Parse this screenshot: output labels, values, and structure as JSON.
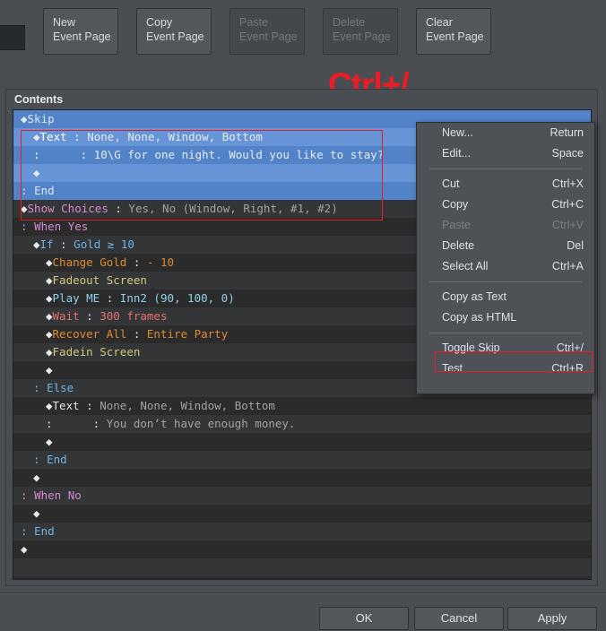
{
  "toolbar": {
    "buttons": [
      {
        "line1": "New",
        "line2": "Event Page",
        "disabled": false
      },
      {
        "line1": "Copy",
        "line2": "Event Page",
        "disabled": false
      },
      {
        "line1": "Paste",
        "line2": "Event Page",
        "disabled": true
      },
      {
        "line1": "Delete",
        "line2": "Event Page",
        "disabled": true
      },
      {
        "line1": "Clear",
        "line2": "Event Page",
        "disabled": false
      }
    ]
  },
  "annotation": {
    "shortcut_text": "Ctrl+/",
    "color": "#ed1c24"
  },
  "contents": {
    "label": "Contents",
    "rows": [
      {
        "selected": true,
        "indent": 0,
        "segs": [
          {
            "t": "◆",
            "c": "dia"
          },
          {
            "t": "Skip",
            "c": "c-blue"
          }
        ]
      },
      {
        "selected": true,
        "indent": 1,
        "segs": [
          {
            "t": "◆",
            "c": "dia"
          },
          {
            "t": "Text",
            "c": "c-white"
          },
          {
            "t": " : ",
            "c": "c-white"
          },
          {
            "t": "None, None, Window, Bottom",
            "c": "c-gray"
          }
        ]
      },
      {
        "selected": true,
        "indent": 1,
        "segs": [
          {
            "t": ":      : ",
            "c": "c-white"
          },
          {
            "t": "10\\G for one night. Would you like to stay?",
            "c": "c-gray"
          }
        ]
      },
      {
        "selected": true,
        "indent": 1,
        "segs": [
          {
            "t": "◆",
            "c": "dia"
          }
        ]
      },
      {
        "selected": true,
        "indent": 0,
        "segs": [
          {
            "t": ": ",
            "c": "c-blue"
          },
          {
            "t": "End",
            "c": "c-blue"
          }
        ]
      },
      {
        "selected": false,
        "indent": 0,
        "segs": [
          {
            "t": "◆",
            "c": "dia"
          },
          {
            "t": "Show Choices",
            "c": "c-pink"
          },
          {
            "t": " : ",
            "c": "c-white"
          },
          {
            "t": "Yes, No (Window, Right, #1, #2)",
            "c": "c-gray"
          }
        ]
      },
      {
        "selected": false,
        "indent": 0,
        "segs": [
          {
            "t": ": ",
            "c": "c-pink"
          },
          {
            "t": "When Yes",
            "c": "c-pink"
          }
        ]
      },
      {
        "selected": false,
        "indent": 1,
        "segs": [
          {
            "t": "◆",
            "c": "dia"
          },
          {
            "t": "If",
            "c": "c-blue"
          },
          {
            "t": " : ",
            "c": "c-white"
          },
          {
            "t": "Gold ≥ 10",
            "c": "c-blue"
          }
        ]
      },
      {
        "selected": false,
        "indent": 2,
        "segs": [
          {
            "t": "◆",
            "c": "dia"
          },
          {
            "t": "Change Gold",
            "c": "c-orange"
          },
          {
            "t": " : ",
            "c": "c-white"
          },
          {
            "t": "- 10",
            "c": "c-orange"
          }
        ]
      },
      {
        "selected": false,
        "indent": 2,
        "segs": [
          {
            "t": "◆",
            "c": "dia"
          },
          {
            "t": "Fadeout Screen",
            "c": "c-olive"
          }
        ]
      },
      {
        "selected": false,
        "indent": 2,
        "segs": [
          {
            "t": "◆",
            "c": "dia"
          },
          {
            "t": "Play ME",
            "c": "c-cyan"
          },
          {
            "t": " : ",
            "c": "c-white"
          },
          {
            "t": "Inn2 (90, 100, 0)",
            "c": "c-cyan"
          }
        ]
      },
      {
        "selected": false,
        "indent": 2,
        "segs": [
          {
            "t": "◆",
            "c": "dia"
          },
          {
            "t": "Wait",
            "c": "c-salmon"
          },
          {
            "t": " : ",
            "c": "c-white"
          },
          {
            "t": "300 frames",
            "c": "c-salmon"
          }
        ]
      },
      {
        "selected": false,
        "indent": 2,
        "segs": [
          {
            "t": "◆",
            "c": "dia"
          },
          {
            "t": "Recover All",
            "c": "c-orange"
          },
          {
            "t": " : ",
            "c": "c-white"
          },
          {
            "t": "Entire Party",
            "c": "c-orange"
          }
        ]
      },
      {
        "selected": false,
        "indent": 2,
        "segs": [
          {
            "t": "◆",
            "c": "dia"
          },
          {
            "t": "Fadein Screen",
            "c": "c-olive"
          }
        ]
      },
      {
        "selected": false,
        "indent": 2,
        "segs": [
          {
            "t": "◆",
            "c": "dia"
          }
        ]
      },
      {
        "selected": false,
        "indent": 1,
        "segs": [
          {
            "t": ": ",
            "c": "c-blue"
          },
          {
            "t": "Else",
            "c": "c-blue"
          }
        ]
      },
      {
        "selected": false,
        "indent": 2,
        "segs": [
          {
            "t": "◆",
            "c": "dia"
          },
          {
            "t": "Text",
            "c": "c-white"
          },
          {
            "t": " : ",
            "c": "c-white"
          },
          {
            "t": "None, None, Window, Bottom",
            "c": "c-gray"
          }
        ]
      },
      {
        "selected": false,
        "indent": 2,
        "segs": [
          {
            "t": ":      : ",
            "c": "c-white"
          },
          {
            "t": "You don’t have enough money.",
            "c": "c-gray"
          }
        ]
      },
      {
        "selected": false,
        "indent": 2,
        "segs": [
          {
            "t": "◆",
            "c": "dia"
          }
        ]
      },
      {
        "selected": false,
        "indent": 1,
        "segs": [
          {
            "t": ": ",
            "c": "c-blue"
          },
          {
            "t": "End",
            "c": "c-blue"
          }
        ]
      },
      {
        "selected": false,
        "indent": 1,
        "segs": [
          {
            "t": "◆",
            "c": "dia"
          }
        ]
      },
      {
        "selected": false,
        "indent": 0,
        "segs": [
          {
            "t": ": ",
            "c": "c-pink"
          },
          {
            "t": "When No",
            "c": "c-pink"
          }
        ]
      },
      {
        "selected": false,
        "indent": 1,
        "segs": [
          {
            "t": "◆",
            "c": "dia"
          }
        ]
      },
      {
        "selected": false,
        "indent": 0,
        "segs": [
          {
            "t": ": ",
            "c": "c-blue"
          },
          {
            "t": "End",
            "c": "c-blue"
          }
        ]
      },
      {
        "selected": false,
        "indent": 0,
        "segs": [
          {
            "t": "◆",
            "c": "dia"
          }
        ]
      },
      {
        "selected": false,
        "indent": 0,
        "segs": []
      },
      {
        "selected": false,
        "indent": 0,
        "segs": []
      }
    ]
  },
  "context_menu": {
    "items": [
      {
        "type": "item",
        "label": "New...",
        "accel": "Return",
        "disabled": false,
        "highlighted": false
      },
      {
        "type": "item",
        "label": "Edit...",
        "accel": "Space",
        "disabled": false,
        "highlighted": false
      },
      {
        "type": "separator"
      },
      {
        "type": "item",
        "label": "Cut",
        "accel": "Ctrl+X",
        "disabled": false,
        "highlighted": false
      },
      {
        "type": "item",
        "label": "Copy",
        "accel": "Ctrl+C",
        "disabled": false,
        "highlighted": false
      },
      {
        "type": "item",
        "label": "Paste",
        "accel": "Ctrl+V",
        "disabled": true,
        "highlighted": false
      },
      {
        "type": "item",
        "label": "Delete",
        "accel": "Del",
        "disabled": false,
        "highlighted": false
      },
      {
        "type": "item",
        "label": "Select All",
        "accel": "Ctrl+A",
        "disabled": false,
        "highlighted": false
      },
      {
        "type": "separator"
      },
      {
        "type": "item",
        "label": "Copy as Text",
        "accel": "",
        "disabled": false,
        "highlighted": false
      },
      {
        "type": "item",
        "label": "Copy as HTML",
        "accel": "",
        "disabled": false,
        "highlighted": false
      },
      {
        "type": "separator"
      },
      {
        "type": "item",
        "label": "Toggle Skip",
        "accel": "Ctrl+/",
        "disabled": false,
        "highlighted": true
      },
      {
        "type": "item",
        "label": "Test",
        "accel": "Ctrl+R",
        "disabled": false,
        "highlighted": false
      }
    ]
  },
  "footer": {
    "buttons": [
      {
        "label": "OK"
      },
      {
        "label": "Cancel"
      },
      {
        "label": "Apply"
      }
    ]
  }
}
